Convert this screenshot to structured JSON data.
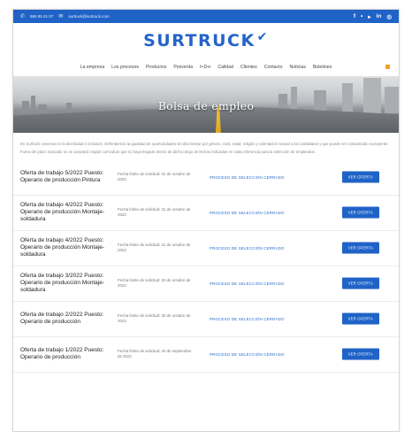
{
  "topbar": {
    "phone": "955 85 01 07",
    "email": "surtruck@surtruck.com",
    "social_icons": [
      "facebook-icon",
      "twitter-icon",
      "youtube-icon",
      "linkedin-icon",
      "instagram-icon"
    ],
    "social_glyphs": [
      "f",
      "•",
      "▸",
      "in",
      "◎"
    ]
  },
  "logo": {
    "text": "SURTRUCK",
    "mark": "✔"
  },
  "nav": {
    "items": [
      "La empresa",
      "Los procesos",
      "Productos",
      "Posventa",
      "I+D+i",
      "Calidad",
      "Clientes",
      "Contacto",
      "Noticias",
      "Boletines"
    ]
  },
  "hero": {
    "title": "Bolsa de empleo"
  },
  "intro": {
    "p1": "En Surtruck creemos en la diversidad e inclusión. Defendemos la igualdad de oportunidades sin discriminar por género, raza, edad, religión y orientación sexual a los candidatos y que puede ser considerado excluyente.",
    "p2": "Fuera del plazo marcado no se aceptará ningún curriculum que no haya llegado dentro de dicho rango de fechas indicadas en cada referencia para la selección de empleados."
  },
  "jobs": [
    {
      "title": "Oferta de trabajo 5/2022 Puesto: Operario de producción Pintura",
      "deadline": "Fecha límite de solicitud: 31 de octubre de 2022",
      "status": "PROCESO DE SELECCIÓN CERRADO",
      "button": "VER OFERTA"
    },
    {
      "title": "Oferta de trabajo 4/2022 Puesto: Operario de producción Montaje-soldadura",
      "deadline": "Fecha límite de solicitud: 31 de octubre de 2022",
      "status": "PROCESO DE SELECCIÓN CERRADO",
      "button": "VER OFERTA"
    },
    {
      "title": "Oferta de trabajo 4/2022 Puesto: Operario de producción Montaje-soldadura",
      "deadline": "Fecha límite de solicitud: 31 de octubre de 2022",
      "status": "PROCESO DE SELECCIÓN CERRADO",
      "button": "VER OFERTA"
    },
    {
      "title": "Oferta de trabajo 3/2022 Puesto: Operario de producción Montaje-soldadura",
      "deadline": "Fecha límite de solicitud: 20 de octubre de 2022",
      "status": "PROCESO DE SELECCIÓN CERRADO",
      "button": "VER OFERTA"
    },
    {
      "title": "Oferta de trabajo 2/2022 Puesto: Operario de producción",
      "deadline": "Fecha límite de solicitud: 30 de octubre de 2022",
      "status": "PROCESO DE SELECCIÓN CERRADO",
      "button": "VER OFERTA"
    },
    {
      "title": "Oferta de trabajo 1/2022 Puesto: Operario de producción",
      "deadline": "Fecha límite de solicitud: 20 de septiembre de 2022",
      "status": "PROCESO DE SELECCIÓN CERRADO",
      "button": "VER OFERTA"
    }
  ],
  "colors": {
    "brand": "#1f63c7",
    "accent": "#f4a020",
    "status_text": "#2a6cc9"
  }
}
